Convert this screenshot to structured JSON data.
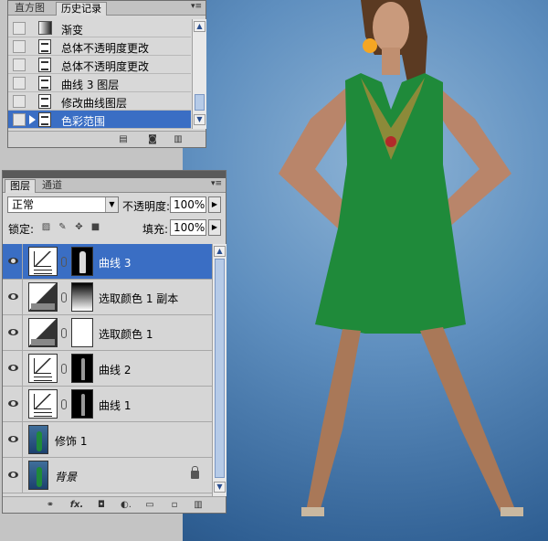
{
  "history_panel": {
    "tabs": [
      {
        "label": "直方图",
        "active": false
      },
      {
        "label": "历史记录",
        "active": true
      }
    ],
    "items": [
      {
        "label": "渐变",
        "icon": "gradient-icon",
        "selected": false
      },
      {
        "label": "总体不透明度更改",
        "icon": "document-icon",
        "selected": false
      },
      {
        "label": "总体不透明度更改",
        "icon": "document-icon",
        "selected": false
      },
      {
        "label": "曲线 3 图层",
        "icon": "document-icon",
        "selected": false
      },
      {
        "label": "修改曲线图层",
        "icon": "document-icon",
        "selected": false
      },
      {
        "label": "色彩范围",
        "icon": "document-icon",
        "selected": true
      }
    ],
    "bottom_icons": [
      "new-document-icon",
      "snapshot-icon",
      "trash-icon"
    ]
  },
  "layers_panel": {
    "tabs": [
      {
        "label": "图层",
        "active": true
      },
      {
        "label": "通道",
        "active": false
      }
    ],
    "blend_mode": "正常",
    "opacity_label": "不透明度:",
    "opacity_value": "100%",
    "lock_label": "锁定:",
    "fill_label": "填充:",
    "fill_value": "100%",
    "layers": [
      {
        "name": "曲线 3",
        "type": "curves",
        "mask": "figure",
        "selected": true
      },
      {
        "name": "选取颜色 1 副本",
        "type": "selective-color",
        "mask": "gradient",
        "selected": false
      },
      {
        "name": "选取颜色 1",
        "type": "selective-color",
        "mask": "white",
        "selected": false
      },
      {
        "name": "曲线 2",
        "type": "curves",
        "mask": "figure-thin",
        "selected": false
      },
      {
        "name": "曲线 1",
        "type": "curves",
        "mask": "figure-thin",
        "selected": false
      },
      {
        "name": "修饰 1",
        "type": "photo",
        "selected": false
      },
      {
        "name": "背景",
        "type": "photo",
        "locked": true,
        "selected": false
      }
    ],
    "bottom_icons": [
      "link-icon",
      "fx-icon",
      "mask-icon",
      "adjustment-icon",
      "folder-icon",
      "new-layer-icon",
      "trash-icon"
    ],
    "bottom_glyphs": [
      "⚭",
      "fx.",
      "◘",
      "◐.",
      "▭",
      "▫",
      "▥"
    ]
  },
  "colors": {
    "selection": "#3a6ec4",
    "panel_bg": "#d8d8d8",
    "canvas_blue": "#2f5f93",
    "dress_green": "#1f8a3a"
  }
}
